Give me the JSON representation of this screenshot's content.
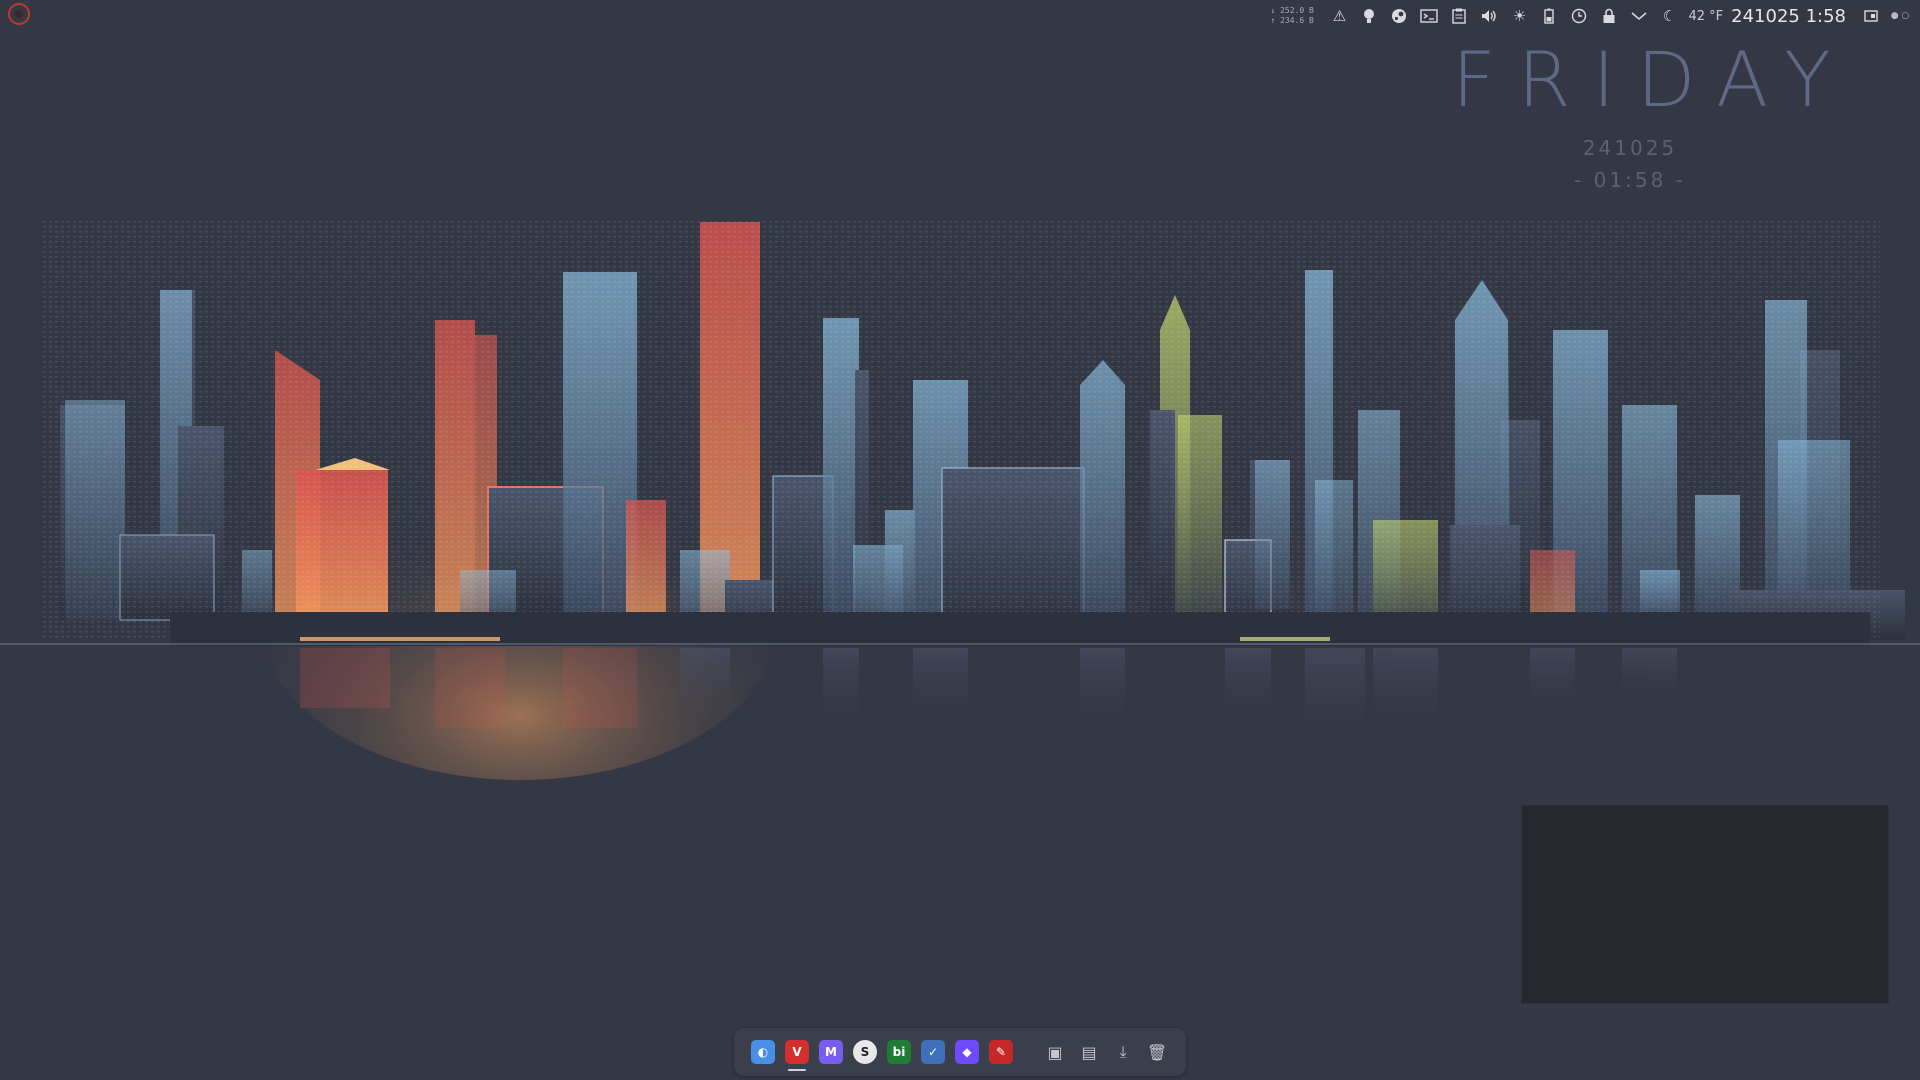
{
  "panel": {
    "launcher_icon": "distro-logo-icon",
    "net_down": "↓ 252.0 B",
    "net_up": "↑ 234.6 B",
    "tray_icons": [
      "notifications-icon",
      "lightbulb-icon",
      "steam-icon",
      "terminal-icon",
      "clipboard-icon",
      "volume-icon",
      "brightness-icon",
      "battery-icon",
      "clock-icon",
      "lock-icon",
      "chevron-down-icon",
      "moon-icon"
    ],
    "temperature": "42 °F",
    "clock": "241025 1:58",
    "show_desktop_icon": "window-icon",
    "overflow_icon": "dots-icon"
  },
  "widget": {
    "day": "FRIDAY",
    "date": "241025",
    "time": "- 01:58 -"
  },
  "dock": {
    "apps": [
      {
        "name": "copilot-icon",
        "color": "#4a8fe7",
        "glyph": "◐",
        "active": false
      },
      {
        "name": "vivaldi-icon",
        "color": "#d32f2f",
        "glyph": "V",
        "active": true
      },
      {
        "name": "proton-mail-icon",
        "color": "#7b5cf0",
        "glyph": "M",
        "active": false
      },
      {
        "name": "simplenote-icon",
        "color": "#e8e8e8",
        "glyph": "S",
        "active": false
      },
      {
        "name": "beeper-icon",
        "color": "#1e7d32",
        "glyph": "bi",
        "active": false
      },
      {
        "name": "tasks-icon",
        "color": "#3f6fb8",
        "glyph": "✓",
        "active": false
      },
      {
        "name": "proton-vpn-icon",
        "color": "#6d4aff",
        "glyph": "◆",
        "active": false
      },
      {
        "name": "inkscape-icon",
        "color": "#c62828",
        "glyph": "✎",
        "active": false
      }
    ],
    "places": [
      {
        "name": "pictures-folder-icon",
        "glyph": "▣"
      },
      {
        "name": "documents-folder-icon",
        "glyph": "▤"
      },
      {
        "name": "downloads-icon",
        "glyph": "⤓"
      },
      {
        "name": "trash-icon",
        "glyph": "🗑"
      }
    ]
  },
  "colors": {
    "desktop_bg": "#343844",
    "warm_accent": "#e8705a",
    "cool_accent": "#7fb6d8",
    "lime_accent": "#c8d870"
  }
}
